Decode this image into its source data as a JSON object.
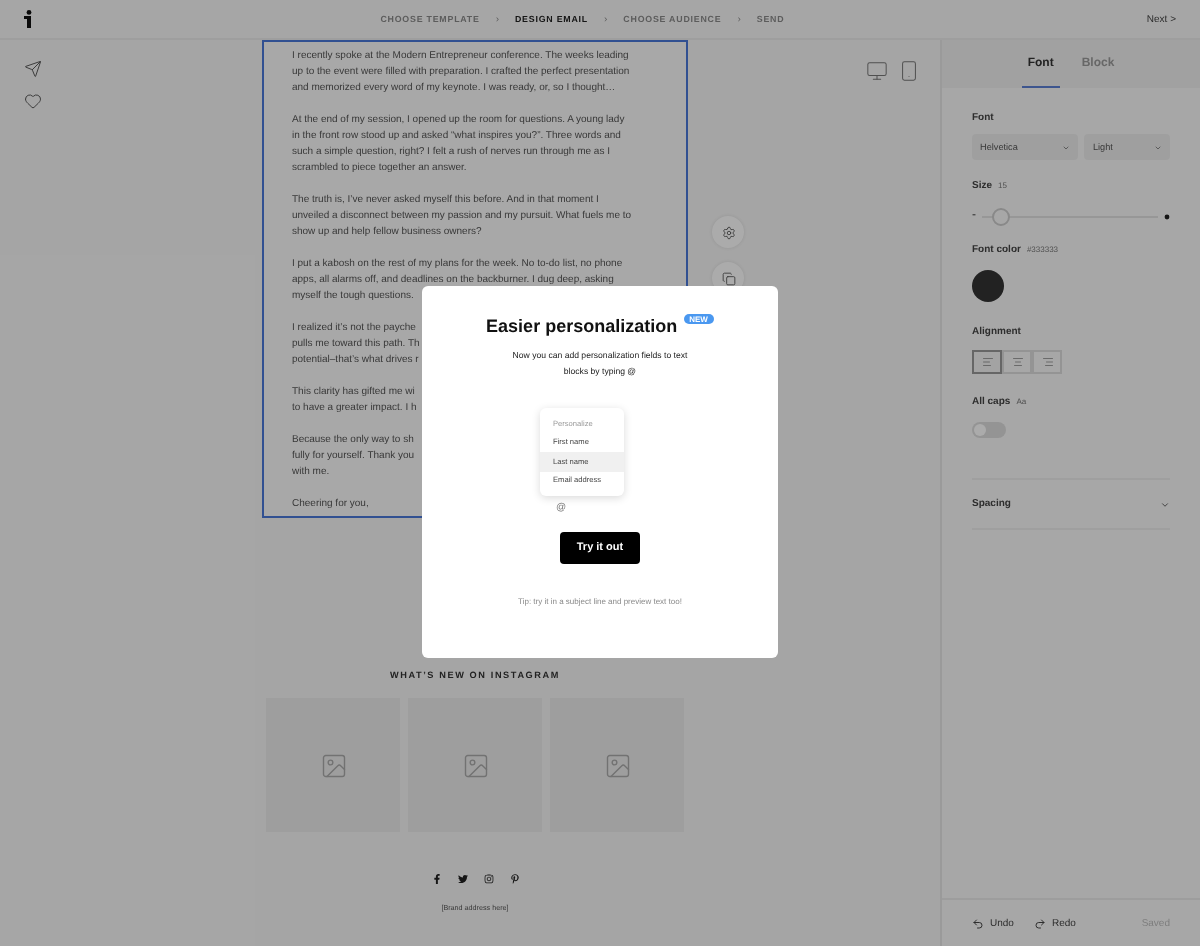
{
  "topbar": {
    "steps": [
      {
        "label": "CHOOSE TEMPLATE",
        "selected": false
      },
      {
        "label": "DESIGN EMAIL",
        "selected": true
      },
      {
        "label": "CHOOSE AUDIENCE",
        "selected": false
      },
      {
        "label": "SEND",
        "selected": false
      }
    ],
    "separator": "›",
    "next": "Next >"
  },
  "email": {
    "paragraphs": [
      {
        "lines": [
          "I recently spoke at the Modern Entrepreneur conference. The weeks leading",
          "up to the event were filled with preparation. I crafted the perfect presentation",
          "and memorized every word of my keynote. I was ready, or, so I thought…"
        ]
      },
      {
        "lines": [
          "At the end of my session, I opened up the room for questions. A young lady",
          "in the front row stood up and asked “what inspires you?”. Three words and",
          "such a simple question, right? I felt a rush of nerves run through me as I",
          "scrambled to piece together an answer."
        ]
      },
      {
        "lines": [
          "The truth is, I’ve never asked myself this before. And in that moment I",
          "unveiled a disconnect between my passion and my pursuit. What fuels me to",
          "show up and help fellow business owners?"
        ]
      },
      {
        "lines": [
          "I put a kabosh on the rest of my plans for the week. No to-do list, no phone",
          "apps, all alarms off, and deadlines on the backburner. I dug deep, asking",
          "myself the tough questions."
        ]
      },
      {
        "lines": [
          "I realized it’s not the payche",
          "pulls me toward this path. Th",
          "potential–that’s what drives r"
        ]
      },
      {
        "lines": [
          "This clarity has gifted me wi",
          "to have a greater impact. I h"
        ]
      },
      {
        "lines": [
          "Because the only way to sh",
          "fully for yourself. Thank you",
          "with me."
        ]
      },
      {
        "lines": [
          "Cheering for you,"
        ]
      }
    ],
    "instagram_heading": "WHAT’S NEW ON INSTAGRAM",
    "footer_address": "[Brand address here]"
  },
  "modal": {
    "title": "Easier personalization",
    "badge": "NEW",
    "text": "Now you can add personalization fields to text blocks by typing @",
    "menu": [
      {
        "label": "Personalize",
        "kind": "header",
        "selected": false
      },
      {
        "label": "First name",
        "kind": "item",
        "selected": false
      },
      {
        "label": "Last name",
        "kind": "item",
        "selected": true
      },
      {
        "label": "Email address",
        "kind": "item",
        "selected": false
      }
    ],
    "at": "@",
    "button": "Try it out",
    "tip": "Tip: try it in a subject line and preview text too!"
  },
  "panel": {
    "tabs": [
      {
        "label": "Font",
        "selected": true
      },
      {
        "label": "Block",
        "selected": false
      }
    ],
    "font_label": "Font",
    "font_family": "Helvetica",
    "font_weight": "Light",
    "size_label": "Size",
    "size_value": "15",
    "size_min": "-",
    "size": {
      "level": 0.1
    },
    "color_label": "Font color",
    "color_value": "#333333",
    "alignment_label": "Alignment",
    "alignment": [
      {
        "kind": "left",
        "selected": true
      },
      {
        "kind": "center",
        "selected": false
      },
      {
        "kind": "right",
        "selected": false
      }
    ],
    "caps_label": "All caps",
    "caps_hint": "Aa",
    "caps_on": false,
    "spacing_label": "Spacing",
    "spacing_expanded": false
  },
  "footer": {
    "undo": "Undo",
    "redo": "Redo",
    "status": "Saved"
  }
}
